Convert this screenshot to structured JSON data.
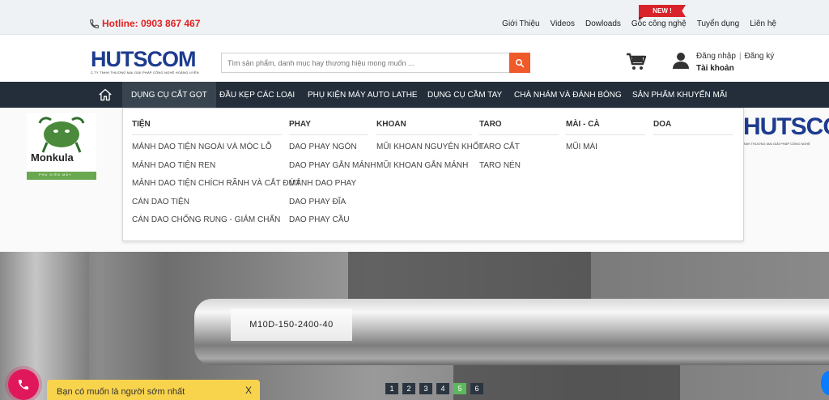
{
  "topbar": {
    "hotline": "Hotline: 0903 867 467",
    "new_badge": "NEW !",
    "links": [
      "Giới Thiệu",
      "Videos",
      "Dowloads",
      "Góc công nghệ",
      "Tuyển dụng",
      "Liên hệ"
    ]
  },
  "header": {
    "logo_text": "HUTSCOM",
    "logo_sub": "C.TY TNHH THƯƠNG MẠI GIẢI PHÁP CÔNG NGHỆ HOÀNG UYÊN",
    "search_placeholder": "Tìm sản phẩm, danh mục hay thương hiệu mong muốn ...",
    "login": "Đăng nhập",
    "register": "Đăng ký",
    "account": "Tài khoản"
  },
  "nav": {
    "items": [
      "DỤNG CỤ CẮT GỌT",
      "ĐẦU KẸP CÁC LOẠI",
      "PHỤ KIỆN MÁY AUTO LATHE",
      "DỤNG CỤ CẦM TAY",
      "CHÀ NHÁM VÀ ĐÁNH BÓNG",
      "SẢN PHẨM KHUYẾN MÃI"
    ]
  },
  "mega_menu": {
    "columns": [
      {
        "title": "TIỆN",
        "items": [
          "MẢNH DAO TIỆN NGOÀI VÀ MÓC LỖ",
          "MẢNH DAO TIỆN REN",
          "MẢNH DAO TIỆN CHÍCH RÃNH VÀ CẮT ĐỨT",
          "CÁN DAO TIỆN",
          "CÁN DAO CHỐNG RUNG - GIẢM CHẤN"
        ]
      },
      {
        "title": "PHAY",
        "items": [
          "DAO PHAY NGÓN",
          "DAO PHAY GẮN MẢNH",
          "MẢNH DAO PHAY",
          "DAO PHAY ĐĨA",
          "DAO PHAY CẦU"
        ]
      },
      {
        "title": "KHOAN",
        "items": [
          "MŨI KHOAN NGUYÊN KHỐI",
          "MŨI KHOAN GẮN MẢNH"
        ]
      },
      {
        "title": "TARO",
        "items": [
          "TARO CẮT",
          "TARO NÉN"
        ]
      },
      {
        "title": "MÀI - CÀ",
        "items": [
          "MŨI MÀI"
        ]
      },
      {
        "title": "DOA",
        "items": []
      }
    ]
  },
  "banner": {
    "brand_left": "Monkula",
    "brand_left_sub": "PHỤ KIỆN MÁY",
    "brand_right": "HUTSCOM",
    "brand_right_sub": "ANH THƯƠNG MẠI GIẢI PHÁP CÔNG NGHỆ",
    "rod_label": "M10D-150-2400-40"
  },
  "slider": {
    "pages": [
      "1",
      "2",
      "3",
      "4",
      "5",
      "6"
    ],
    "active_index": 4
  },
  "notice": {
    "text": "Bạn có muốn là người sớm nhất",
    "close": "X"
  },
  "colors": {
    "nav_bg": "#232e3a",
    "accent": "#f0592a",
    "hotline": "#e02020",
    "brand": "#1d3c8f",
    "slider_active": "#5cb85c",
    "notice_bg": "#f8d34c",
    "phone_fab": "#e0185b"
  },
  "icons": [
    "phone-icon",
    "search-icon",
    "cart-icon",
    "user-icon",
    "home-icon",
    "phone-call-icon"
  ]
}
